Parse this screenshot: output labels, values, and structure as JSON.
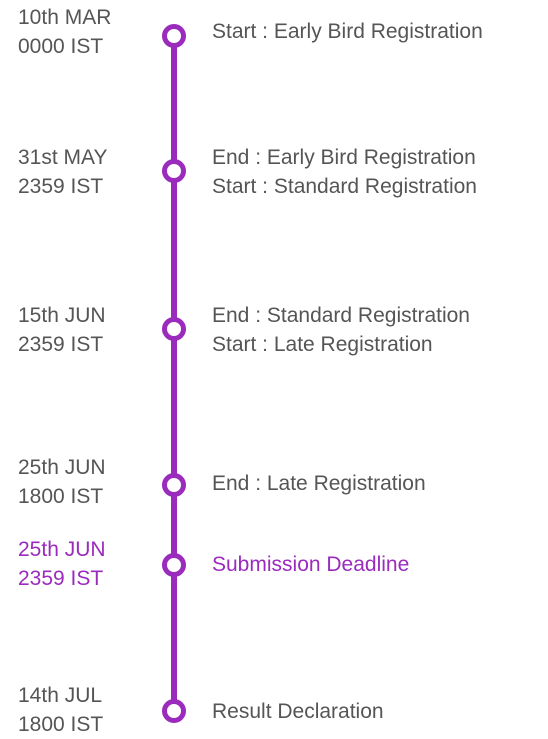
{
  "accent_color": "#9b2bbd",
  "events": [
    {
      "date": "10th MAR",
      "time": "0000 IST",
      "lines": [
        "Start : Early Bird Registration"
      ]
    },
    {
      "date": "31st MAY",
      "time": "2359 IST",
      "lines": [
        "End : Early Bird Registration",
        "Start : Standard Registration"
      ]
    },
    {
      "date": "15th JUN",
      "time": "2359 IST",
      "lines": [
        "End : Standard Registration",
        "Start : Late Registration"
      ]
    },
    {
      "date": "25th JUN",
      "time": "1800 IST",
      "lines": [
        "End : Late Registration"
      ]
    },
    {
      "date": "25th JUN",
      "time": "2359 IST",
      "lines": [
        "Submission Deadline"
      ],
      "highlighted": true
    },
    {
      "date": "14th JUL",
      "time": "1800 IST",
      "lines": [
        "Result Declaration"
      ]
    }
  ]
}
